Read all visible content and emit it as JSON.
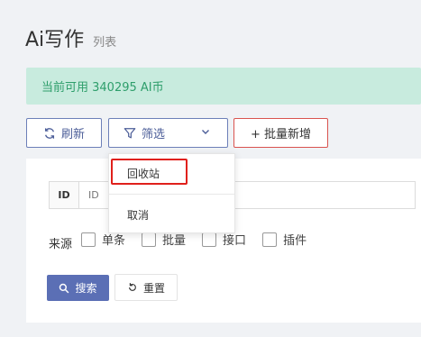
{
  "header": {
    "title": "Ai写作",
    "subtitle": "列表"
  },
  "banner": {
    "text": "当前可用 340295 AI币"
  },
  "toolbar": {
    "refresh_label": "刷新",
    "filter_label": "筛选",
    "add_label": "+ 批量新增"
  },
  "search": {
    "id_label": "ID",
    "id_placeholder": "ID",
    "source_label": "来源",
    "sources": [
      {
        "label": "单条",
        "checked": false
      },
      {
        "label": "批量",
        "checked": false
      },
      {
        "label": "接口",
        "checked": false
      },
      {
        "label": "插件",
        "checked": false
      }
    ],
    "search_label": "搜索",
    "reset_label": "重置"
  },
  "dropdown": {
    "items": [
      {
        "label": "回收站"
      },
      {
        "label": "取消"
      }
    ]
  },
  "colors": {
    "primary": "#5b6fb5",
    "success_bg": "#c8ebde",
    "success_text": "#2e9e6b",
    "highlight": "#e0201b"
  }
}
